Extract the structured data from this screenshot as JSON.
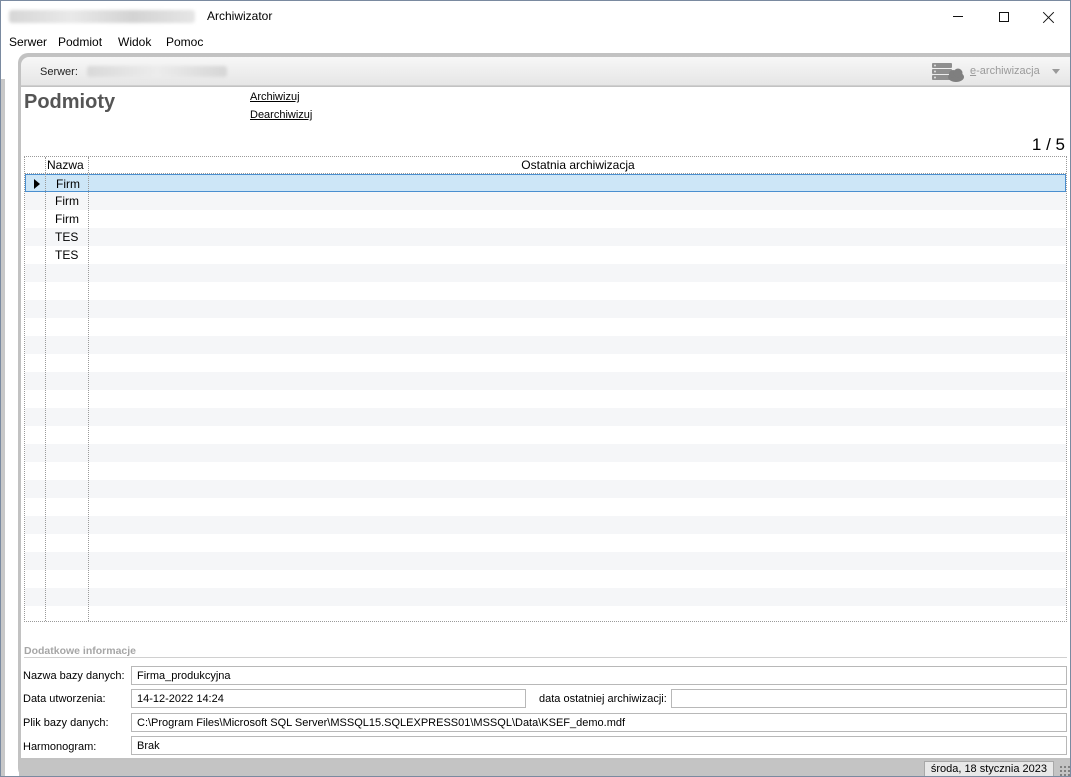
{
  "window": {
    "title": "Archiwizator"
  },
  "menu": [
    "Serwer",
    "Podmiot",
    "Widok",
    "Pomoc"
  ],
  "server_bar": {
    "label": "Serwer:",
    "earchive_prefix": "e",
    "earchive_rest": "-archiwizacja"
  },
  "page": {
    "title": "Podmioty",
    "links": {
      "archive": "Archiwizuj",
      "unarchive": "Dearchiwizuj"
    },
    "pager": "1 / 5"
  },
  "grid": {
    "columns": [
      "Nazwa",
      "Ostatnia archiwizacja"
    ],
    "rows": [
      {
        "name": "Firm",
        "last_archive": "",
        "selected": true
      },
      {
        "name": "Firm",
        "last_archive": ""
      },
      {
        "name": "Firm",
        "last_archive": ""
      },
      {
        "name": "TES",
        "last_archive": ""
      },
      {
        "name": "TES",
        "last_archive": ""
      }
    ],
    "selected_index": 0
  },
  "details": {
    "section_title": "Dodatkowe informacje",
    "db_name_label": "Nazwa bazy danych:",
    "db_name": "Firma_produkcyjna",
    "created_label": "Data utworzenia:",
    "created": "14-12-2022 14:24",
    "last_archive_label": "data ostatniej archiwizacji:",
    "last_archive": "",
    "db_file_label": "Plik bazy danych:",
    "db_file": "C:\\Program Files\\Microsoft SQL Server\\MSSQL15.SQLEXPRESS01\\MSSQL\\Data\\KSEF_demo.mdf",
    "schedule_label": "Harmonogram:",
    "schedule": "Brak"
  },
  "status": {
    "date": "środa, 18 stycznia 2023"
  }
}
